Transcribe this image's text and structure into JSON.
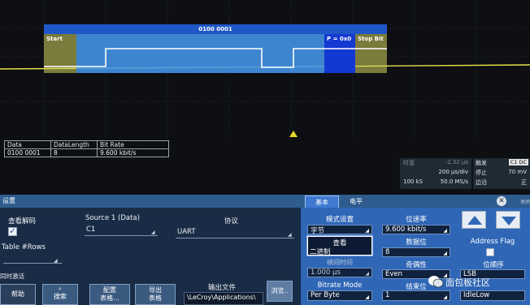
{
  "waveform": {
    "decode_value": "0100 0001",
    "fields": {
      "start": "Start",
      "parity": "P = 0x0",
      "stop": "Stop Bit"
    }
  },
  "decode_table": {
    "headers": [
      "Data",
      "DataLength",
      "Bit Rate"
    ],
    "row": [
      "0100 0001",
      "8",
      "9.600 kbit/s"
    ]
  },
  "timebase": {
    "label": "时基",
    "pos": "-2.32 μs",
    "div": "200 μs/div",
    "samples": "100 kS",
    "rate": "50.0 MS/s"
  },
  "trigger": {
    "label": "触发",
    "channel": "C1 DC",
    "mode": "停止",
    "level": "70 mV",
    "type": "边沿",
    "slope": "正"
  },
  "dialog": {
    "title": "设置",
    "tabs": [
      "基本",
      "电平"
    ],
    "close_label": "关闭",
    "view_decode_label": "查看解码",
    "table_rows_label": "Table #Rows",
    "sync_label": "同时激活",
    "source_label": "Source 1 (Data)",
    "source_value": "C1",
    "protocol_label": "协议",
    "protocol_value": "UART",
    "buttons": {
      "help": "帮助",
      "search": "搜索",
      "config_table": [
        "配置",
        "表格..."
      ],
      "export_table": [
        "导出",
        "表格"
      ],
      "browse": "浏览.."
    },
    "output_file_label": "输出文件",
    "output_file_value": "\\LeCroy\\Applications\\"
  },
  "basic_panel": {
    "mode_label": "模式设置",
    "mode_value": "字节",
    "view_label": "查看",
    "view_value": "二进制",
    "interframe_label": "帧间时间",
    "interframe_value": "1.000 μs",
    "bitrate_mode_label": "Bitrate Mode",
    "bitrate_mode_value": "Per Byte",
    "bit_rate_label": "位速率",
    "bit_rate_value": "9.600 kbit/s",
    "data_bits_label": "数据位",
    "data_bits_value": "8",
    "parity_label": "奇偶性",
    "parity_value": "Even",
    "stop_bits_label": "结束位",
    "stop_bits_value": "1",
    "address_flag_label": "Address Flag",
    "bit_order_label": "位顺序",
    "bit_order_value": "LSB",
    "polarity_value": "IdleLow"
  },
  "watermark": "面包板社区",
  "colors": {
    "trace": "#e8e24a",
    "decode_blue": "#4696eb",
    "parity_blue": "#1438d2",
    "start_stop": "#d6d65f",
    "dialog_bg": "#1a2c45",
    "panel_blue": "#2f66b6"
  }
}
